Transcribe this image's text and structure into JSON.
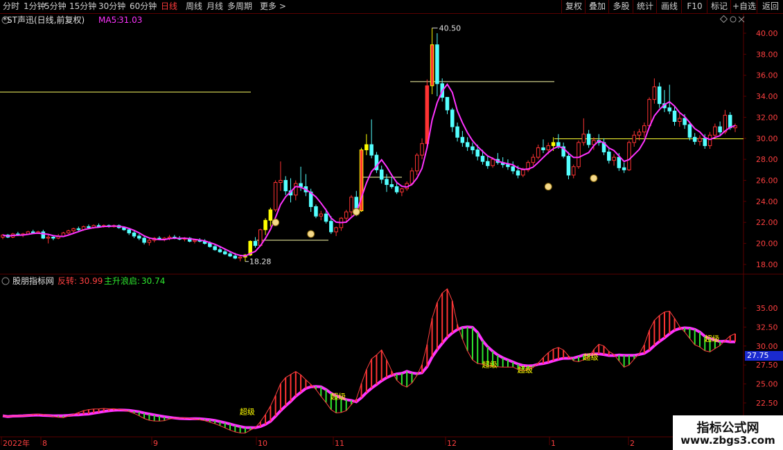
{
  "toolbar": {
    "left": [
      "分时",
      "1分钟",
      "5分钟",
      "15分钟",
      "30分钟",
      "60分钟",
      "日线",
      "周线",
      "月线",
      "多周期",
      "更多 >"
    ],
    "active_index": 6,
    "right": [
      "复权",
      "叠加",
      "多股",
      "统计",
      "画线",
      "F10",
      "标记",
      "+自选",
      "返回"
    ]
  },
  "main_panel": {
    "title": "*ST声迅(日线,前复权)",
    "ma_label": "MA5:",
    "ma_value": "31.03",
    "y_ticks": [
      "40.00",
      "38.00",
      "36.00",
      "34.00",
      "32.00",
      "30.00",
      "28.00",
      "26.00",
      "24.00",
      "22.00",
      "20.00",
      "18.00"
    ],
    "high_label": "40.50",
    "low_label": "18.28",
    "icons": [
      "diamond-icon",
      "settings-icon",
      "close-icon"
    ]
  },
  "indicator_panel": {
    "name": "股朋指标网",
    "label1": "反转:",
    "value1": "30.99",
    "label2": "主升浪启:",
    "value2": "30.74",
    "y_ticks": [
      "35.00",
      "32.50",
      "30.00",
      "27.50",
      "25.00",
      "22.50"
    ],
    "current_value": "27.75",
    "signal_text": "超级"
  },
  "x_axis": {
    "labels": [
      "2022年",
      "8",
      "9",
      "10",
      "11",
      "12",
      "1",
      "2"
    ]
  },
  "watermark": {
    "line1": "指标公式网",
    "line2": "www.zbgs3.com"
  },
  "colors": {
    "up": "#ff3333",
    "down": "#54ffff",
    "ma": "#ff33ff",
    "yellow": "#ffff00",
    "green_bar": "#2ee82e",
    "grid": "#5a0000"
  },
  "chart_data": [
    {
      "type": "candlestick",
      "title": "*ST声迅(日线,前复权)",
      "series_name": "MA5",
      "y_range": [
        17.5,
        41
      ],
      "candles": [
        [
          20.6,
          20.9,
          20.4,
          20.8
        ],
        [
          20.8,
          20.9,
          20.5,
          20.6
        ],
        [
          20.6,
          21.0,
          20.5,
          20.9
        ],
        [
          20.9,
          21.1,
          20.7,
          20.8
        ],
        [
          20.8,
          21.0,
          20.6,
          20.9
        ],
        [
          20.9,
          21.2,
          20.8,
          21.1
        ],
        [
          21.1,
          21.3,
          20.9,
          21.0
        ],
        [
          21.0,
          21.2,
          20.9,
          21.1
        ],
        [
          21.1,
          21.3,
          20.4,
          20.5
        ],
        [
          20.5,
          20.8,
          20.0,
          20.6
        ],
        [
          20.6,
          20.8,
          20.3,
          20.5
        ],
        [
          20.5,
          20.9,
          20.4,
          20.7
        ],
        [
          20.7,
          21.1,
          20.6,
          21.0
        ],
        [
          21.0,
          21.3,
          20.9,
          21.2
        ],
        [
          21.2,
          21.5,
          21.0,
          21.4
        ],
        [
          21.4,
          21.6,
          21.2,
          21.3
        ],
        [
          21.3,
          21.7,
          21.2,
          21.6
        ],
        [
          21.6,
          21.8,
          21.4,
          21.5
        ],
        [
          21.5,
          21.8,
          21.4,
          21.7
        ],
        [
          21.7,
          21.9,
          21.5,
          21.6
        ],
        [
          21.6,
          21.8,
          21.5,
          21.7
        ],
        [
          21.7,
          21.8,
          21.5,
          21.6
        ],
        [
          21.6,
          21.8,
          21.5,
          21.7
        ],
        [
          21.7,
          21.8,
          21.4,
          21.5
        ],
        [
          21.5,
          21.6,
          21.2,
          21.3
        ],
        [
          21.3,
          21.4,
          20.8,
          21.0
        ],
        [
          21.0,
          21.2,
          20.5,
          20.7
        ],
        [
          20.7,
          20.9,
          20.3,
          20.5
        ],
        [
          20.5,
          20.7,
          19.9,
          20.1
        ],
        [
          20.1,
          20.5,
          19.8,
          20.3
        ],
        [
          20.3,
          20.6,
          20.1,
          20.5
        ],
        [
          20.5,
          20.7,
          20.3,
          20.4
        ],
        [
          20.4,
          20.6,
          20.2,
          20.5
        ],
        [
          20.5,
          20.8,
          20.3,
          20.6
        ],
        [
          20.6,
          20.8,
          20.4,
          20.5
        ],
        [
          20.5,
          20.7,
          20.3,
          20.4
        ],
        [
          20.4,
          20.6,
          20.2,
          20.5
        ],
        [
          20.5,
          20.6,
          20.1,
          20.2
        ],
        [
          20.2,
          20.4,
          20.0,
          20.3
        ],
        [
          20.3,
          20.5,
          20.1,
          20.2
        ],
        [
          20.2,
          20.4,
          19.9,
          20.0
        ],
        [
          20.0,
          20.2,
          19.6,
          19.7
        ],
        [
          19.7,
          19.9,
          19.3,
          19.4
        ],
        [
          19.4,
          19.7,
          19.1,
          19.2
        ],
        [
          19.2,
          19.5,
          18.9,
          19.0
        ],
        [
          19.0,
          19.2,
          18.7,
          18.8
        ],
        [
          18.8,
          19.1,
          18.5,
          18.6
        ],
        [
          18.6,
          18.9,
          18.3,
          18.7
        ],
        [
          18.7,
          19.0,
          18.28,
          18.9
        ],
        [
          18.9,
          20.3,
          18.8,
          20.2
        ],
        [
          20.2,
          20.6,
          19.6,
          19.8
        ],
        [
          19.8,
          21.4,
          19.7,
          21.3
        ],
        [
          21.3,
          22.4,
          20.8,
          22.2
        ],
        [
          22.2,
          23.4,
          21.6,
          23.2
        ],
        [
          23.2,
          26.0,
          23.0,
          25.8
        ],
        [
          25.8,
          27.8,
          25.0,
          26.0
        ],
        [
          26.0,
          26.4,
          24.6,
          25.0
        ],
        [
          25.0,
          26.2,
          23.9,
          24.6
        ],
        [
          24.6,
          26.0,
          24.1,
          25.7
        ],
        [
          25.7,
          27.3,
          25.0,
          25.4
        ],
        [
          25.4,
          26.6,
          24.5,
          24.9
        ],
        [
          24.9,
          25.2,
          23.0,
          23.5
        ],
        [
          23.5,
          23.7,
          22.4,
          22.6
        ],
        [
          22.6,
          23.1,
          22.2,
          22.8
        ],
        [
          22.8,
          23.3,
          21.9,
          22.1
        ],
        [
          22.1,
          22.6,
          20.9,
          21.1
        ],
        [
          21.1,
          21.6,
          20.7,
          21.5
        ],
        [
          21.5,
          22.5,
          21.2,
          22.4
        ],
        [
          22.4,
          23.2,
          22.0,
          23.0
        ],
        [
          23.0,
          24.6,
          22.6,
          24.4
        ],
        [
          24.4,
          25.0,
          22.6,
          23.1
        ],
        [
          23.1,
          29.1,
          23.0,
          28.9
        ],
        [
          28.9,
          30.4,
          28.4,
          29.4
        ],
        [
          29.4,
          31.8,
          28.1,
          28.4
        ],
        [
          28.4,
          28.7,
          26.7,
          27.0
        ],
        [
          27.0,
          27.4,
          25.7,
          26.1
        ],
        [
          26.1,
          26.6,
          24.9,
          25.6
        ],
        [
          25.6,
          26.3,
          25.2,
          25.4
        ],
        [
          25.4,
          25.9,
          24.7,
          24.9
        ],
        [
          24.9,
          25.3,
          24.5,
          25.2
        ],
        [
          25.2,
          25.9,
          25.0,
          25.7
        ],
        [
          25.7,
          27.2,
          25.5,
          26.9
        ],
        [
          26.9,
          28.6,
          26.5,
          28.4
        ],
        [
          28.4,
          30.0,
          28.0,
          29.5
        ],
        [
          29.5,
          35.6,
          29.0,
          35.0
        ],
        [
          35.0,
          40.5,
          34.2,
          38.9
        ],
        [
          38.9,
          40.0,
          34.0,
          35.2
        ],
        [
          35.2,
          35.7,
          33.5,
          33.9
        ],
        [
          33.9,
          33.9,
          32.3,
          32.7
        ],
        [
          32.7,
          32.9,
          30.6,
          31.1
        ],
        [
          31.1,
          31.5,
          29.7,
          30.1
        ],
        [
          30.1,
          30.7,
          29.2,
          29.6
        ],
        [
          29.6,
          30.1,
          28.8,
          29.2
        ],
        [
          29.2,
          29.6,
          28.5,
          28.9
        ],
        [
          28.9,
          29.4,
          27.9,
          28.3
        ],
        [
          28.3,
          28.9,
          27.5,
          27.8
        ],
        [
          27.8,
          28.4,
          27.1,
          27.4
        ],
        [
          27.4,
          28.2,
          27.2,
          28.0
        ],
        [
          28.0,
          28.6,
          27.5,
          27.7
        ],
        [
          27.7,
          28.2,
          27.2,
          27.5
        ],
        [
          27.5,
          28.0,
          27.0,
          27.3
        ],
        [
          27.3,
          27.8,
          26.6,
          26.9
        ],
        [
          26.9,
          27.4,
          26.2,
          26.5
        ],
        [
          26.5,
          27.2,
          26.3,
          27.0
        ],
        [
          27.0,
          27.9,
          26.8,
          27.7
        ],
        [
          27.7,
          28.5,
          27.4,
          28.2
        ],
        [
          28.2,
          29.4,
          28.0,
          29.1
        ],
        [
          29.1,
          29.9,
          28.6,
          28.9
        ],
        [
          28.9,
          29.6,
          28.5,
          29.3
        ],
        [
          29.3,
          30.1,
          28.8,
          29.6
        ],
        [
          29.6,
          30.4,
          29.0,
          29.2
        ],
        [
          29.2,
          29.6,
          28.1,
          28.3
        ],
        [
          28.3,
          28.7,
          26.1,
          26.5
        ],
        [
          26.5,
          27.5,
          26.2,
          27.3
        ],
        [
          27.3,
          29.8,
          27.1,
          29.6
        ],
        [
          29.6,
          31.9,
          29.3,
          30.4
        ],
        [
          30.4,
          30.8,
          29.1,
          29.4
        ],
        [
          29.4,
          30.1,
          28.9,
          29.8
        ],
        [
          29.8,
          30.4,
          29.3,
          29.6
        ],
        [
          29.6,
          30.0,
          28.4,
          28.7
        ],
        [
          28.7,
          29.1,
          27.6,
          27.9
        ],
        [
          27.9,
          28.5,
          27.4,
          28.2
        ],
        [
          28.2,
          28.6,
          26.9,
          27.2
        ],
        [
          27.2,
          27.7,
          26.7,
          27.0
        ],
        [
          27.0,
          29.8,
          26.9,
          29.6
        ],
        [
          29.6,
          30.7,
          29.2,
          30.3
        ],
        [
          30.3,
          30.9,
          29.8,
          30.6
        ],
        [
          30.6,
          31.5,
          30.1,
          31.2
        ],
        [
          31.2,
          33.9,
          31.0,
          33.7
        ],
        [
          33.7,
          35.7,
          33.3,
          34.9
        ],
        [
          34.9,
          35.3,
          32.9,
          33.3
        ],
        [
          33.3,
          34.6,
          32.5,
          32.9
        ],
        [
          32.9,
          35.1,
          32.3,
          32.6
        ],
        [
          32.6,
          33.0,
          31.2,
          31.6
        ],
        [
          31.6,
          32.5,
          31.1,
          31.9
        ],
        [
          31.9,
          32.3,
          30.9,
          31.3
        ],
        [
          31.3,
          31.6,
          29.8,
          30.1
        ],
        [
          30.1,
          30.5,
          29.4,
          29.7
        ],
        [
          29.7,
          30.3,
          29.3,
          30.0
        ],
        [
          30.0,
          30.4,
          29.0,
          29.3
        ],
        [
          29.3,
          30.6,
          29.0,
          30.3
        ],
        [
          30.3,
          31.4,
          30.0,
          31.1
        ],
        [
          31.1,
          31.6,
          30.2,
          30.6
        ],
        [
          30.6,
          32.7,
          30.4,
          32.2
        ],
        [
          32.2,
          32.5,
          30.8,
          31.0
        ],
        [
          31.0,
          31.4,
          30.6,
          31.2
        ]
      ],
      "y_ticks": [
        40,
        38,
        36,
        34,
        32,
        30,
        28,
        26,
        24,
        22,
        20,
        18
      ],
      "annotations": [
        "40.50",
        "18.28"
      ]
    },
    {
      "type": "bar",
      "title": "股朋指标网",
      "series": [
        {
          "name": "反转",
          "last_value": 30.99
        },
        {
          "name": "主升浪启",
          "last_value": 30.74
        }
      ],
      "y_range": [
        20.5,
        38.5
      ],
      "y_ticks": [
        35.0,
        32.5,
        30.0,
        27.5,
        25.0,
        22.5
      ],
      "current_value": 27.75
    }
  ]
}
